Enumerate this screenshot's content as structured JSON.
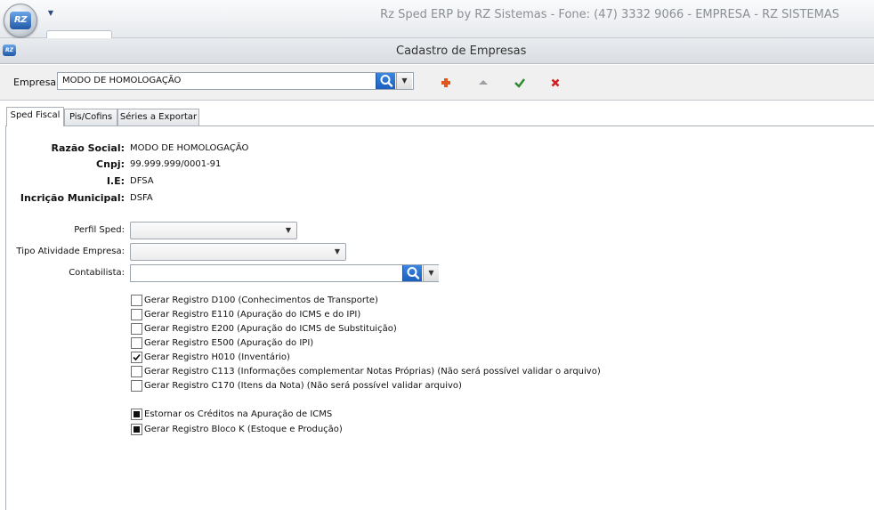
{
  "window": {
    "title": "Rz Sped ERP by RZ Sistemas - Fone: (47) 3332 9066 - EMPRESA - RZ SISTEMAS",
    "logo_text": "RZ"
  },
  "form": {
    "caption": "Cadastro de Empresas",
    "caption_icon_text": "RZ"
  },
  "toolbar": {
    "empresa_label": "Empresa",
    "empresa_value": "MODO DE HOMOLOGAÇÃO",
    "icons": [
      "add-icon",
      "up-icon",
      "confirm-icon",
      "delete-icon"
    ],
    "colors": {
      "add": "#e0561c",
      "up": "#9aa0a6",
      "confirm": "#2f8a2f",
      "delete": "#d0201f",
      "search_button": "#2a72d2"
    }
  },
  "tabs": [
    {
      "label": "Sped Fiscal",
      "active": true
    },
    {
      "label": "Pis/Cofins",
      "active": false
    },
    {
      "label": "Séries a Exportar",
      "active": false
    }
  ],
  "company_info": [
    {
      "label": "Razão Social:",
      "value": "MODO DE HOMOLOGAÇÃO"
    },
    {
      "label": "Cnpj:",
      "value": "99.999.999/0001-91"
    },
    {
      "label": "I.E:",
      "value": "DFSA"
    },
    {
      "label": "Incrição Municipal:",
      "value": "DSFA"
    }
  ],
  "fields": {
    "perfil_sped": {
      "label": "Perfil Sped:",
      "value": ""
    },
    "tipo_atividade": {
      "label": "Tipo Atividade Empresa:",
      "value": ""
    },
    "contabilista": {
      "label": "Contabilista:",
      "value": ""
    }
  },
  "checkboxes": [
    {
      "label": "Gerar Registro D100 (Conhecimentos de Transporte)",
      "state": "unchecked"
    },
    {
      "label": "Gerar Registro E110 (Apuração do ICMS e do IPI)",
      "state": "unchecked"
    },
    {
      "label": "Gerar Registro E200 (Apuração do ICMS de Substituição)",
      "state": "unchecked"
    },
    {
      "label": "Gerar Registro E500 (Apuração do IPI)",
      "state": "unchecked"
    },
    {
      "label": "Gerar Registro H010 (Inventário)",
      "state": "checked"
    },
    {
      "label": "Gerar Registro C113 (Informações complementar Notas Próprias) (Não será possível validar o arquivo)",
      "state": "unchecked"
    },
    {
      "label": "Gerar Registro C170 (Itens da Nota) (Não será possível validar arquivo)",
      "state": "unchecked"
    }
  ],
  "checkboxes_extra": [
    {
      "label": "Estornar os Créditos na Apuração de ICMS",
      "state": "indeterminate"
    },
    {
      "label": "Gerar Registro Bloco K (Estoque e Produção)",
      "state": "indeterminate"
    }
  ]
}
